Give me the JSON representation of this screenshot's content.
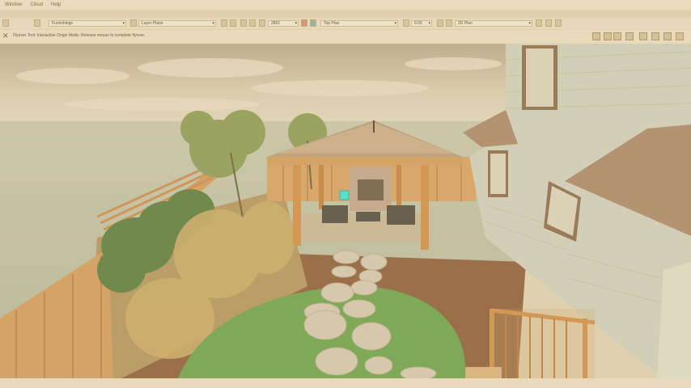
{
  "menu": {
    "items": [
      "Window",
      "Cloud",
      "Help"
    ]
  },
  "toolbar": {
    "category_dropdown": "Furnishings",
    "layer_dropdown": "Layer Plane",
    "zoom_value": "2891",
    "plan_dropdown": "Top Plan",
    "thickness_value": "0.00",
    "view_dropdown": "2D Plan"
  },
  "status": {
    "message": "Flyover Tool: Interactive Origin Mode. Release mouse to complete flyover."
  },
  "scene": {
    "type": "3D backyard rendering",
    "elements": [
      "sky",
      "water",
      "gazebo",
      "house",
      "fence",
      "garden",
      "lawn",
      "stepping-stones",
      "deck",
      "trees"
    ]
  },
  "colors": {
    "tint": "#ded2b5",
    "lawn": "#6aa24a",
    "fence": "#d39a5c",
    "roof": "#b89a78",
    "house": "#cfd0bd",
    "path_soil": "#8a5b39",
    "cursor": "#37e6d8"
  }
}
